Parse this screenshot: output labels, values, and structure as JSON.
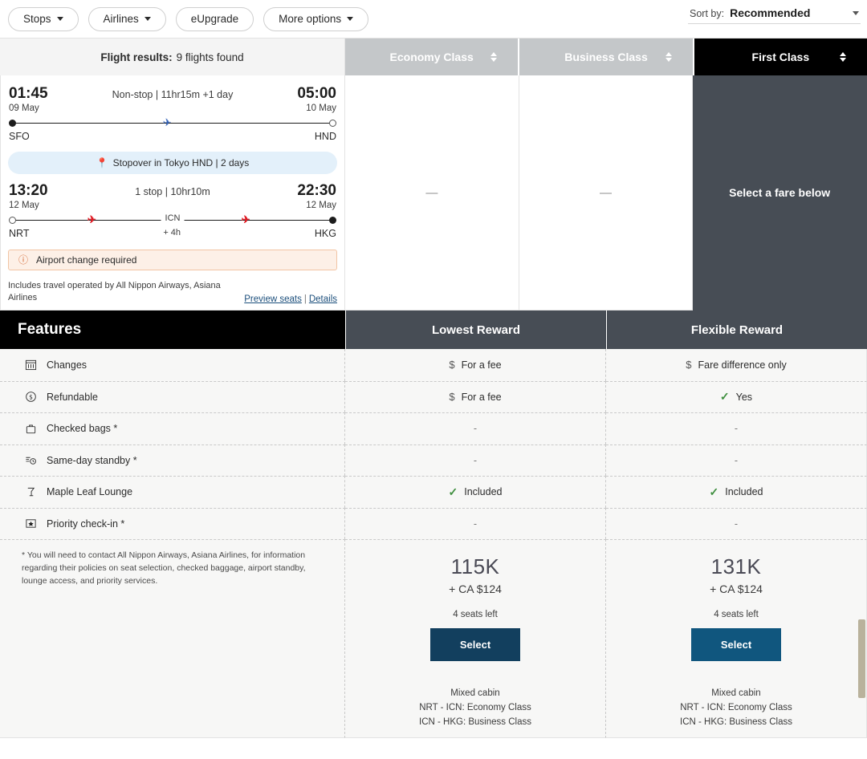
{
  "filters": {
    "items": [
      {
        "label": "Stops",
        "caret": true
      },
      {
        "label": "Airlines",
        "caret": true
      },
      {
        "label": "eUpgrade",
        "caret": false
      },
      {
        "label": "More options",
        "caret": true
      }
    ]
  },
  "sort": {
    "label": "Sort by:",
    "value": "Recommended",
    "icon": "chevron-down-icon"
  },
  "results": {
    "label": "Flight results:",
    "count_text": "9 flights found",
    "cabins": [
      {
        "name": "Economy Class",
        "state": "inactive"
      },
      {
        "name": "Business Class",
        "state": "inactive"
      },
      {
        "name": "First Class",
        "state": "active"
      }
    ]
  },
  "flight": {
    "legs": [
      {
        "depart_time": "01:45",
        "depart_date": "09 May",
        "depart_code": "SFO",
        "summary": "Non-stop | 11hr15m +1 day",
        "arrive_time": "05:00",
        "arrive_date": "10 May",
        "arrive_code": "HND",
        "stop_code": "",
        "stop_layover": "",
        "plane_color": "#2f5fb7"
      },
      {
        "depart_time": "13:20",
        "depart_date": "12 May",
        "depart_code": "NRT",
        "summary": "1 stop | 10hr10m",
        "arrive_time": "22:30",
        "arrive_date": "12 May",
        "arrive_code": "HKG",
        "stop_code": "ICN",
        "stop_layover": "+ 4h",
        "plane_color": "#e01b24"
      }
    ],
    "stopover": {
      "icon": "location-pin-icon",
      "text": "Stopover in Tokyo HND | 2 days"
    },
    "warning": {
      "icon": "alert-circle-icon",
      "text": "Airport change required"
    },
    "operated_by": "Includes travel operated by All Nippon Airways, Asiana Airlines",
    "preview_seats_label": "Preview seats",
    "link_separator": "|",
    "details_label": "Details",
    "cabin_cells": [
      {
        "value": "—",
        "state": "empty"
      },
      {
        "value": "—",
        "state": "empty"
      },
      {
        "value": "Select a fare below",
        "state": "selected"
      }
    ]
  },
  "features": {
    "title": "Features",
    "columns": [
      "Lowest Reward",
      "Flexible Reward"
    ],
    "rows": [
      {
        "icon": "calendar-icon",
        "label": "Changes",
        "values": [
          {
            "mark": "dollar",
            "text": "For a fee"
          },
          {
            "mark": "dollar",
            "text": "Fare difference only"
          }
        ]
      },
      {
        "icon": "refund-dollar-circle-icon",
        "label": "Refundable",
        "values": [
          {
            "mark": "dollar",
            "text": "For a fee"
          },
          {
            "mark": "check",
            "text": "Yes"
          }
        ]
      },
      {
        "icon": "suitcase-icon",
        "label": "Checked bags *",
        "values": [
          {
            "mark": "none",
            "text": "-"
          },
          {
            "mark": "none",
            "text": "-"
          }
        ]
      },
      {
        "icon": "standby-clock-icon",
        "label": "Same-day standby *",
        "values": [
          {
            "mark": "none",
            "text": "-"
          },
          {
            "mark": "none",
            "text": "-"
          }
        ]
      },
      {
        "icon": "lounge-glass-icon",
        "label": "Maple Leaf Lounge",
        "values": [
          {
            "mark": "check",
            "text": "Included"
          },
          {
            "mark": "check",
            "text": "Included"
          }
        ]
      },
      {
        "icon": "priority-star-icon",
        "label": "Priority check-in *",
        "values": [
          {
            "mark": "none",
            "text": "-"
          },
          {
            "mark": "none",
            "text": "-"
          }
        ]
      }
    ],
    "footnote": "* You will need to contact All Nippon Airways, Asiana Airlines, for information regarding their policies on seat selection, checked baggage, airport standby, lounge access, and priority services."
  },
  "fares": [
    {
      "miles": "115K",
      "cash": "+ CA $124",
      "seats": "4 seats left",
      "select_label": "Select",
      "select_color": "#123f5e",
      "mixed_title": "Mixed cabin",
      "mixed_lines": [
        "NRT - ICN: Economy Class",
        "ICN - HKG: Business Class"
      ]
    },
    {
      "miles": "131K",
      "cash": "+ CA $124",
      "seats": "4 seats left",
      "select_label": "Select",
      "select_color": "#10567e",
      "mixed_title": "Mixed cabin",
      "mixed_lines": [
        "NRT - ICN: Economy Class",
        "ICN - HKG: Business Class"
      ]
    }
  ],
  "colors": {
    "accent_dark": "#474d55",
    "active_tab": "#000000",
    "inactive_tab": "#c4c7c9",
    "check_green": "#3f8f3f",
    "warning_bg": "#fdf0e7",
    "stopover_bg": "#e3f0fa"
  }
}
